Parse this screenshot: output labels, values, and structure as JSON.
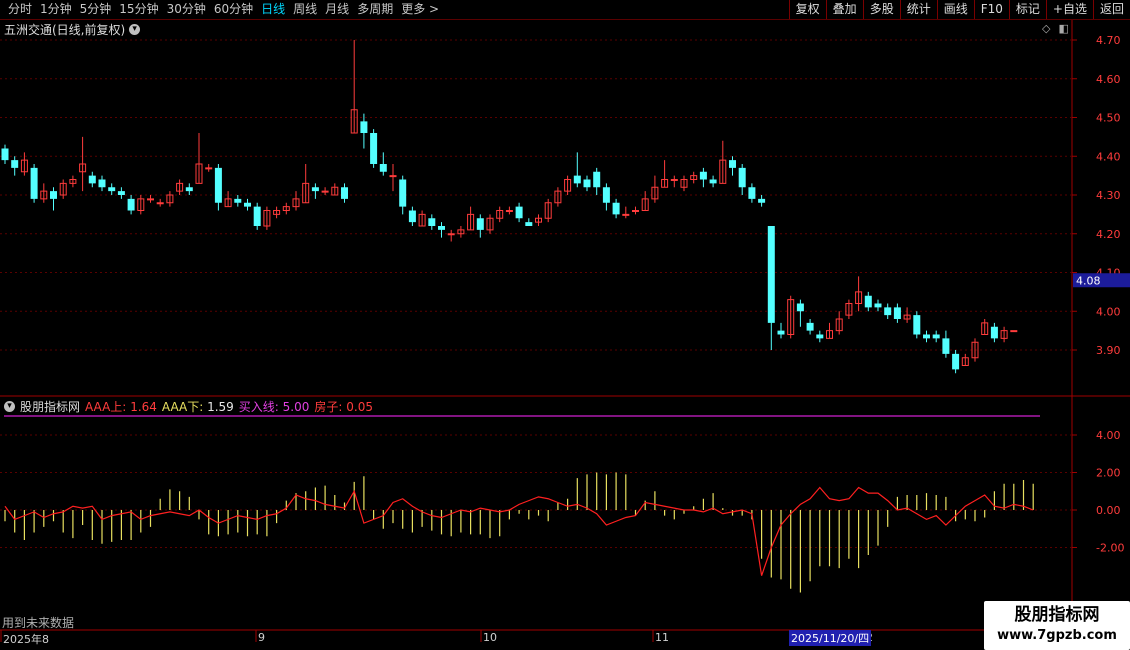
{
  "toolbar": {
    "periods": [
      "分时",
      "1分钟",
      "5分钟",
      "15分钟",
      "30分钟",
      "60分钟",
      "日线",
      "周线",
      "月线",
      "多周期",
      "更多 >"
    ],
    "active_period": "日线",
    "buttons": [
      "复权",
      "叠加",
      "多股",
      "统计",
      "画线",
      "F10",
      "标记",
      "+自选",
      "返回"
    ]
  },
  "chart_title": "五洲交通(日线,前复权)",
  "price_axis": [
    "4.70",
    "4.60",
    "4.50",
    "4.40",
    "4.30",
    "4.20",
    "4.10",
    "4.00",
    "3.90"
  ],
  "current_price_tag": "4.08",
  "indicator": {
    "name": "股朋指标网",
    "aaa_up_label": "AAA上:",
    "aaa_up_value": "1.64",
    "aaa_down_label": "AAA下:",
    "aaa_down_value": "1.59",
    "buy_line_label": "买入线:",
    "buy_line_value": "5.00",
    "house_label": "房子:",
    "house_value": "0.05",
    "axis": [
      "4.00",
      "2.00",
      "0.00",
      "-2.00"
    ]
  },
  "bottom_note": "用到未来数据",
  "date_axis": {
    "labels": [
      "2025年8",
      "9",
      "10",
      "11",
      "2"
    ],
    "highlight": "2025/11/20/四"
  },
  "watermark": {
    "line1": "股朋指标网",
    "line2": "www.7gpzb.com"
  },
  "colors": {
    "up": "#ff3c3c",
    "down": "#54ffff",
    "line": "#ff2020",
    "bar_yellow": "#e8e060",
    "buy_line": "#d020d0"
  },
  "chart_data": {
    "type": "candlestick",
    "ylim": [
      3.8,
      4.72
    ],
    "candles": [
      [
        4.42,
        4.39,
        4.43,
        4.38
      ],
      [
        4.39,
        4.37,
        4.4,
        4.35
      ],
      [
        4.36,
        4.39,
        4.41,
        4.35
      ],
      [
        4.37,
        4.29,
        4.38,
        4.28
      ],
      [
        4.29,
        4.31,
        4.33,
        4.28
      ],
      [
        4.31,
        4.29,
        4.32,
        4.26
      ],
      [
        4.3,
        4.33,
        4.34,
        4.29
      ],
      [
        4.33,
        4.34,
        4.35,
        4.32
      ],
      [
        4.36,
        4.38,
        4.45,
        4.31
      ],
      [
        4.35,
        4.33,
        4.36,
        4.32
      ],
      [
        4.34,
        4.32,
        4.35,
        4.31
      ],
      [
        4.32,
        4.31,
        4.33,
        4.3
      ],
      [
        4.31,
        4.3,
        4.32,
        4.29
      ],
      [
        4.29,
        4.26,
        4.3,
        4.25
      ],
      [
        4.26,
        4.29,
        4.3,
        4.25
      ],
      [
        4.29,
        4.29,
        4.3,
        4.28
      ],
      [
        4.28,
        4.28,
        4.29,
        4.27
      ],
      [
        4.28,
        4.3,
        4.31,
        4.27
      ],
      [
        4.31,
        4.33,
        4.34,
        4.3
      ],
      [
        4.32,
        4.31,
        4.33,
        4.3
      ],
      [
        4.33,
        4.38,
        4.46,
        4.33
      ],
      [
        4.37,
        4.37,
        4.38,
        4.36
      ],
      [
        4.37,
        4.28,
        4.38,
        4.26
      ],
      [
        4.27,
        4.29,
        4.31,
        4.27
      ],
      [
        4.29,
        4.28,
        4.3,
        4.27
      ],
      [
        4.28,
        4.27,
        4.29,
        4.26
      ],
      [
        4.27,
        4.22,
        4.28,
        4.21
      ],
      [
        4.22,
        4.26,
        4.27,
        4.21
      ],
      [
        4.25,
        4.26,
        4.27,
        4.24
      ],
      [
        4.26,
        4.27,
        4.28,
        4.25
      ],
      [
        4.27,
        4.29,
        4.31,
        4.26
      ],
      [
        4.28,
        4.33,
        4.38,
        4.28
      ],
      [
        4.32,
        4.31,
        4.33,
        4.29
      ],
      [
        4.31,
        4.31,
        4.32,
        4.3
      ],
      [
        4.3,
        4.32,
        4.33,
        4.3
      ],
      [
        4.32,
        4.29,
        4.33,
        4.28
      ],
      [
        4.46,
        4.52,
        4.7,
        4.46
      ],
      [
        4.49,
        4.46,
        4.51,
        4.42
      ],
      [
        4.46,
        4.38,
        4.47,
        4.37
      ],
      [
        4.38,
        4.36,
        4.41,
        4.35
      ],
      [
        4.35,
        4.35,
        4.38,
        4.31
      ],
      [
        4.34,
        4.27,
        4.35,
        4.25
      ],
      [
        4.26,
        4.23,
        4.27,
        4.22
      ],
      [
        4.22,
        4.25,
        4.26,
        4.22
      ],
      [
        4.24,
        4.22,
        4.25,
        4.21
      ],
      [
        4.22,
        4.21,
        4.23,
        4.19
      ],
      [
        4.2,
        4.2,
        4.21,
        4.18
      ],
      [
        4.2,
        4.21,
        4.22,
        4.19
      ],
      [
        4.21,
        4.25,
        4.27,
        4.21
      ],
      [
        4.24,
        4.21,
        4.25,
        4.19
      ],
      [
        4.21,
        4.24,
        4.25,
        4.2
      ],
      [
        4.24,
        4.26,
        4.27,
        4.23
      ],
      [
        4.26,
        4.26,
        4.27,
        4.25
      ],
      [
        4.27,
        4.24,
        4.28,
        4.23
      ],
      [
        4.23,
        4.22,
        4.24,
        4.22
      ],
      [
        4.23,
        4.24,
        4.25,
        4.22
      ],
      [
        4.24,
        4.28,
        4.29,
        4.23
      ],
      [
        4.28,
        4.31,
        4.32,
        4.27
      ],
      [
        4.31,
        4.34,
        4.35,
        4.3
      ],
      [
        4.35,
        4.33,
        4.41,
        4.32
      ],
      [
        4.34,
        4.32,
        4.35,
        4.31
      ],
      [
        4.36,
        4.32,
        4.37,
        4.3
      ],
      [
        4.32,
        4.28,
        4.33,
        4.26
      ],
      [
        4.28,
        4.25,
        4.29,
        4.24
      ],
      [
        4.25,
        4.25,
        4.27,
        4.24
      ],
      [
        4.26,
        4.26,
        4.27,
        4.25
      ],
      [
        4.26,
        4.29,
        4.31,
        4.26
      ],
      [
        4.29,
        4.32,
        4.35,
        4.28
      ],
      [
        4.32,
        4.34,
        4.39,
        4.32
      ],
      [
        4.34,
        4.34,
        4.35,
        4.32
      ],
      [
        4.32,
        4.34,
        4.35,
        4.31
      ],
      [
        4.34,
        4.35,
        4.36,
        4.33
      ],
      [
        4.36,
        4.34,
        4.37,
        4.32
      ],
      [
        4.34,
        4.33,
        4.35,
        4.32
      ],
      [
        4.33,
        4.39,
        4.44,
        4.33
      ],
      [
        4.39,
        4.37,
        4.4,
        4.35
      ],
      [
        4.37,
        4.32,
        4.38,
        4.3
      ],
      [
        4.32,
        4.29,
        4.33,
        4.28
      ],
      [
        4.29,
        4.28,
        4.3,
        4.27
      ],
      [
        4.22,
        3.97,
        4.22,
        3.9
      ],
      [
        3.95,
        3.94,
        3.97,
        3.93
      ],
      [
        3.94,
        4.03,
        4.04,
        3.93
      ],
      [
        4.02,
        4.0,
        4.03,
        3.96
      ],
      [
        3.97,
        3.95,
        3.98,
        3.94
      ],
      [
        3.94,
        3.93,
        3.95,
        3.92
      ],
      [
        3.93,
        3.95,
        3.97,
        3.93
      ],
      [
        3.95,
        3.98,
        4.0,
        3.94
      ],
      [
        3.99,
        4.02,
        4.03,
        3.98
      ],
      [
        4.02,
        4.05,
        4.09,
        4.0
      ],
      [
        4.04,
        4.01,
        4.05,
        4.0
      ],
      [
        4.02,
        4.01,
        4.03,
        4.0
      ],
      [
        4.01,
        3.99,
        4.02,
        3.98
      ],
      [
        4.01,
        3.98,
        4.02,
        3.97
      ],
      [
        3.98,
        3.99,
        4.01,
        3.97
      ],
      [
        3.99,
        3.94,
        4.0,
        3.93
      ],
      [
        3.94,
        3.93,
        3.95,
        3.92
      ],
      [
        3.94,
        3.93,
        3.95,
        3.92
      ],
      [
        3.93,
        3.89,
        3.95,
        3.88
      ],
      [
        3.89,
        3.85,
        3.9,
        3.84
      ],
      [
        3.86,
        3.88,
        3.89,
        3.86
      ],
      [
        3.88,
        3.92,
        3.93,
        3.87
      ],
      [
        3.94,
        3.97,
        3.98,
        3.94
      ],
      [
        3.96,
        3.93,
        3.97,
        3.92
      ],
      [
        3.93,
        3.95,
        3.96,
        3.92
      ],
      [
        3.95,
        3.95,
        3.95,
        3.95
      ]
    ],
    "indicator_series": [
      0.2,
      -0.5,
      -0.3,
      -0.1,
      -0.4,
      -0.2,
      -0.1,
      0.2,
      0.1,
      0.2,
      -0.5,
      -0.3,
      -0.2,
      -0.1,
      -0.5,
      -0.3,
      -0.2,
      -0.1,
      -0.2,
      -0.3,
      0.0,
      -0.4,
      -0.7,
      -0.5,
      -0.3,
      -0.4,
      -0.5,
      -0.3,
      -0.2,
      0.1,
      0.8,
      0.6,
      0.5,
      0.3,
      0.2,
      0.1,
      1.0,
      -0.7,
      -0.5,
      -0.3,
      0.4,
      0.6,
      0.2,
      -0.1,
      -0.3,
      -0.4,
      -0.2,
      0.0,
      -0.1,
      0.1,
      0.0,
      -0.1,
      0.0,
      0.3,
      0.5,
      0.7,
      0.6,
      0.4,
      0.2,
      0.3,
      0.1,
      -0.2,
      -0.8,
      -0.6,
      -0.4,
      -0.3,
      0.4,
      0.3,
      0.2,
      0.1,
      0.0,
      0.0,
      -0.1,
      0.1,
      -0.2,
      -0.1,
      0.0,
      -0.2,
      -3.5,
      -2.0,
      -0.8,
      -0.2,
      0.3,
      0.6,
      1.2,
      0.6,
      0.5,
      0.6,
      1.2,
      0.9,
      0.9,
      0.5,
      0.0,
      0.1,
      -0.2,
      -0.5,
      -0.3,
      -0.8,
      -0.3,
      0.2,
      0.5,
      0.8,
      0.2,
      0.1,
      0.3,
      0.2,
      0.0
    ],
    "indicator_bars": [
      -0.6,
      -1.2,
      -1.6,
      -1.2,
      -0.9,
      -0.6,
      -1.2,
      -1.5,
      -0.8,
      -1.6,
      -1.8,
      -1.7,
      -1.6,
      -1.6,
      -1.2,
      -0.9,
      0.6,
      1.1,
      1.0,
      0.7,
      -0.5,
      -1.3,
      -1.4,
      -1.3,
      -1.2,
      -1.4,
      -1.3,
      -1.4,
      -0.7,
      0.5,
      0.9,
      1.0,
      1.2,
      1.3,
      0.8,
      0.4,
      1.5,
      1.8,
      -0.5,
      -1.0,
      -0.7,
      -1.0,
      -1.2,
      -0.9,
      -1.1,
      -1.3,
      -1.4,
      -1.2,
      -1.3,
      -1.3,
      -1.5,
      -1.4,
      -0.5,
      -0.2,
      -0.5,
      -0.3,
      -0.6,
      0.4,
      0.6,
      1.7,
      1.9,
      2.0,
      1.9,
      2.0,
      1.9,
      -0.3,
      0.5,
      1.0,
      -0.3,
      -0.5,
      -0.2,
      0.2,
      0.6,
      0.9,
      0.1,
      -0.3,
      -0.3,
      -0.5,
      -2.6,
      -3.6,
      -3.7,
      -4.2,
      -4.4,
      -3.8,
      -3.0,
      -3.0,
      -3.1,
      -2.6,
      -3.1,
      -2.4,
      -1.9,
      -0.9,
      0.7,
      0.8,
      0.8,
      0.9,
      0.8,
      0.7,
      -0.6,
      -0.5,
      -0.6,
      -0.4,
      1.0,
      1.4,
      1.4,
      1.6,
      1.4
    ],
    "buy_line": 5.0
  }
}
